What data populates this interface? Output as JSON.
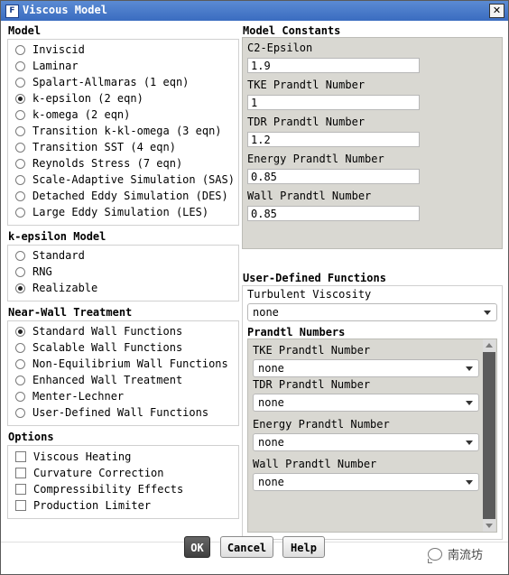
{
  "window": {
    "title": "Viscous Model",
    "icon_letter": "F"
  },
  "model": {
    "title": "Model",
    "options": [
      {
        "label": "Inviscid",
        "selected": false
      },
      {
        "label": "Laminar",
        "selected": false
      },
      {
        "label": "Spalart-Allmaras (1 eqn)",
        "selected": false
      },
      {
        "label": "k-epsilon (2 eqn)",
        "selected": true
      },
      {
        "label": "k-omega (2 eqn)",
        "selected": false
      },
      {
        "label": "Transition k-kl-omega (3 eqn)",
        "selected": false
      },
      {
        "label": "Transition SST (4 eqn)",
        "selected": false
      },
      {
        "label": "Reynolds Stress (7 eqn)",
        "selected": false
      },
      {
        "label": "Scale-Adaptive Simulation (SAS)",
        "selected": false
      },
      {
        "label": "Detached Eddy Simulation (DES)",
        "selected": false
      },
      {
        "label": "Large Eddy Simulation (LES)",
        "selected": false
      }
    ]
  },
  "ke_model": {
    "title": "k-epsilon Model",
    "options": [
      {
        "label": "Standard",
        "selected": false
      },
      {
        "label": "RNG",
        "selected": false
      },
      {
        "label": "Realizable",
        "selected": true
      }
    ]
  },
  "near_wall": {
    "title": "Near-Wall Treatment",
    "options": [
      {
        "label": "Standard Wall Functions",
        "selected": true
      },
      {
        "label": "Scalable Wall Functions",
        "selected": false
      },
      {
        "label": "Non-Equilibrium Wall Functions",
        "selected": false
      },
      {
        "label": "Enhanced Wall Treatment",
        "selected": false
      },
      {
        "label": "Menter-Lechner",
        "selected": false
      },
      {
        "label": "User-Defined Wall Functions",
        "selected": false
      }
    ]
  },
  "options": {
    "title": "Options",
    "items": [
      {
        "label": "Viscous Heating",
        "checked": false
      },
      {
        "label": "Curvature Correction",
        "checked": false
      },
      {
        "label": "Compressibility Effects",
        "checked": false
      },
      {
        "label": "Production Limiter",
        "checked": false
      }
    ]
  },
  "constants": {
    "title": "Model Constants",
    "fields": [
      {
        "label": "C2-Epsilon",
        "value": "1.9"
      },
      {
        "label": "TKE Prandtl Number",
        "value": "1"
      },
      {
        "label": "TDR Prandtl Number",
        "value": "1.2"
      },
      {
        "label": "Energy Prandtl Number",
        "value": "0.85"
      },
      {
        "label": "Wall Prandtl Number",
        "value": "0.85"
      }
    ]
  },
  "udf": {
    "title": "User-Defined Functions",
    "turbulent_viscosity_label": "Turbulent Viscosity",
    "turbulent_viscosity_value": "none",
    "prandtl_title": "Prandtl Numbers",
    "prandtl": [
      {
        "label": "TKE Prandtl Number",
        "value": "none"
      },
      {
        "label": "TDR Prandtl Number",
        "value": "none"
      },
      {
        "label": "Energy Prandtl Number",
        "value": "none"
      },
      {
        "label": "Wall Prandtl Number",
        "value": "none"
      }
    ]
  },
  "buttons": {
    "ok": "OK",
    "cancel": "Cancel",
    "help": "Help"
  },
  "watermark": "南流坊"
}
